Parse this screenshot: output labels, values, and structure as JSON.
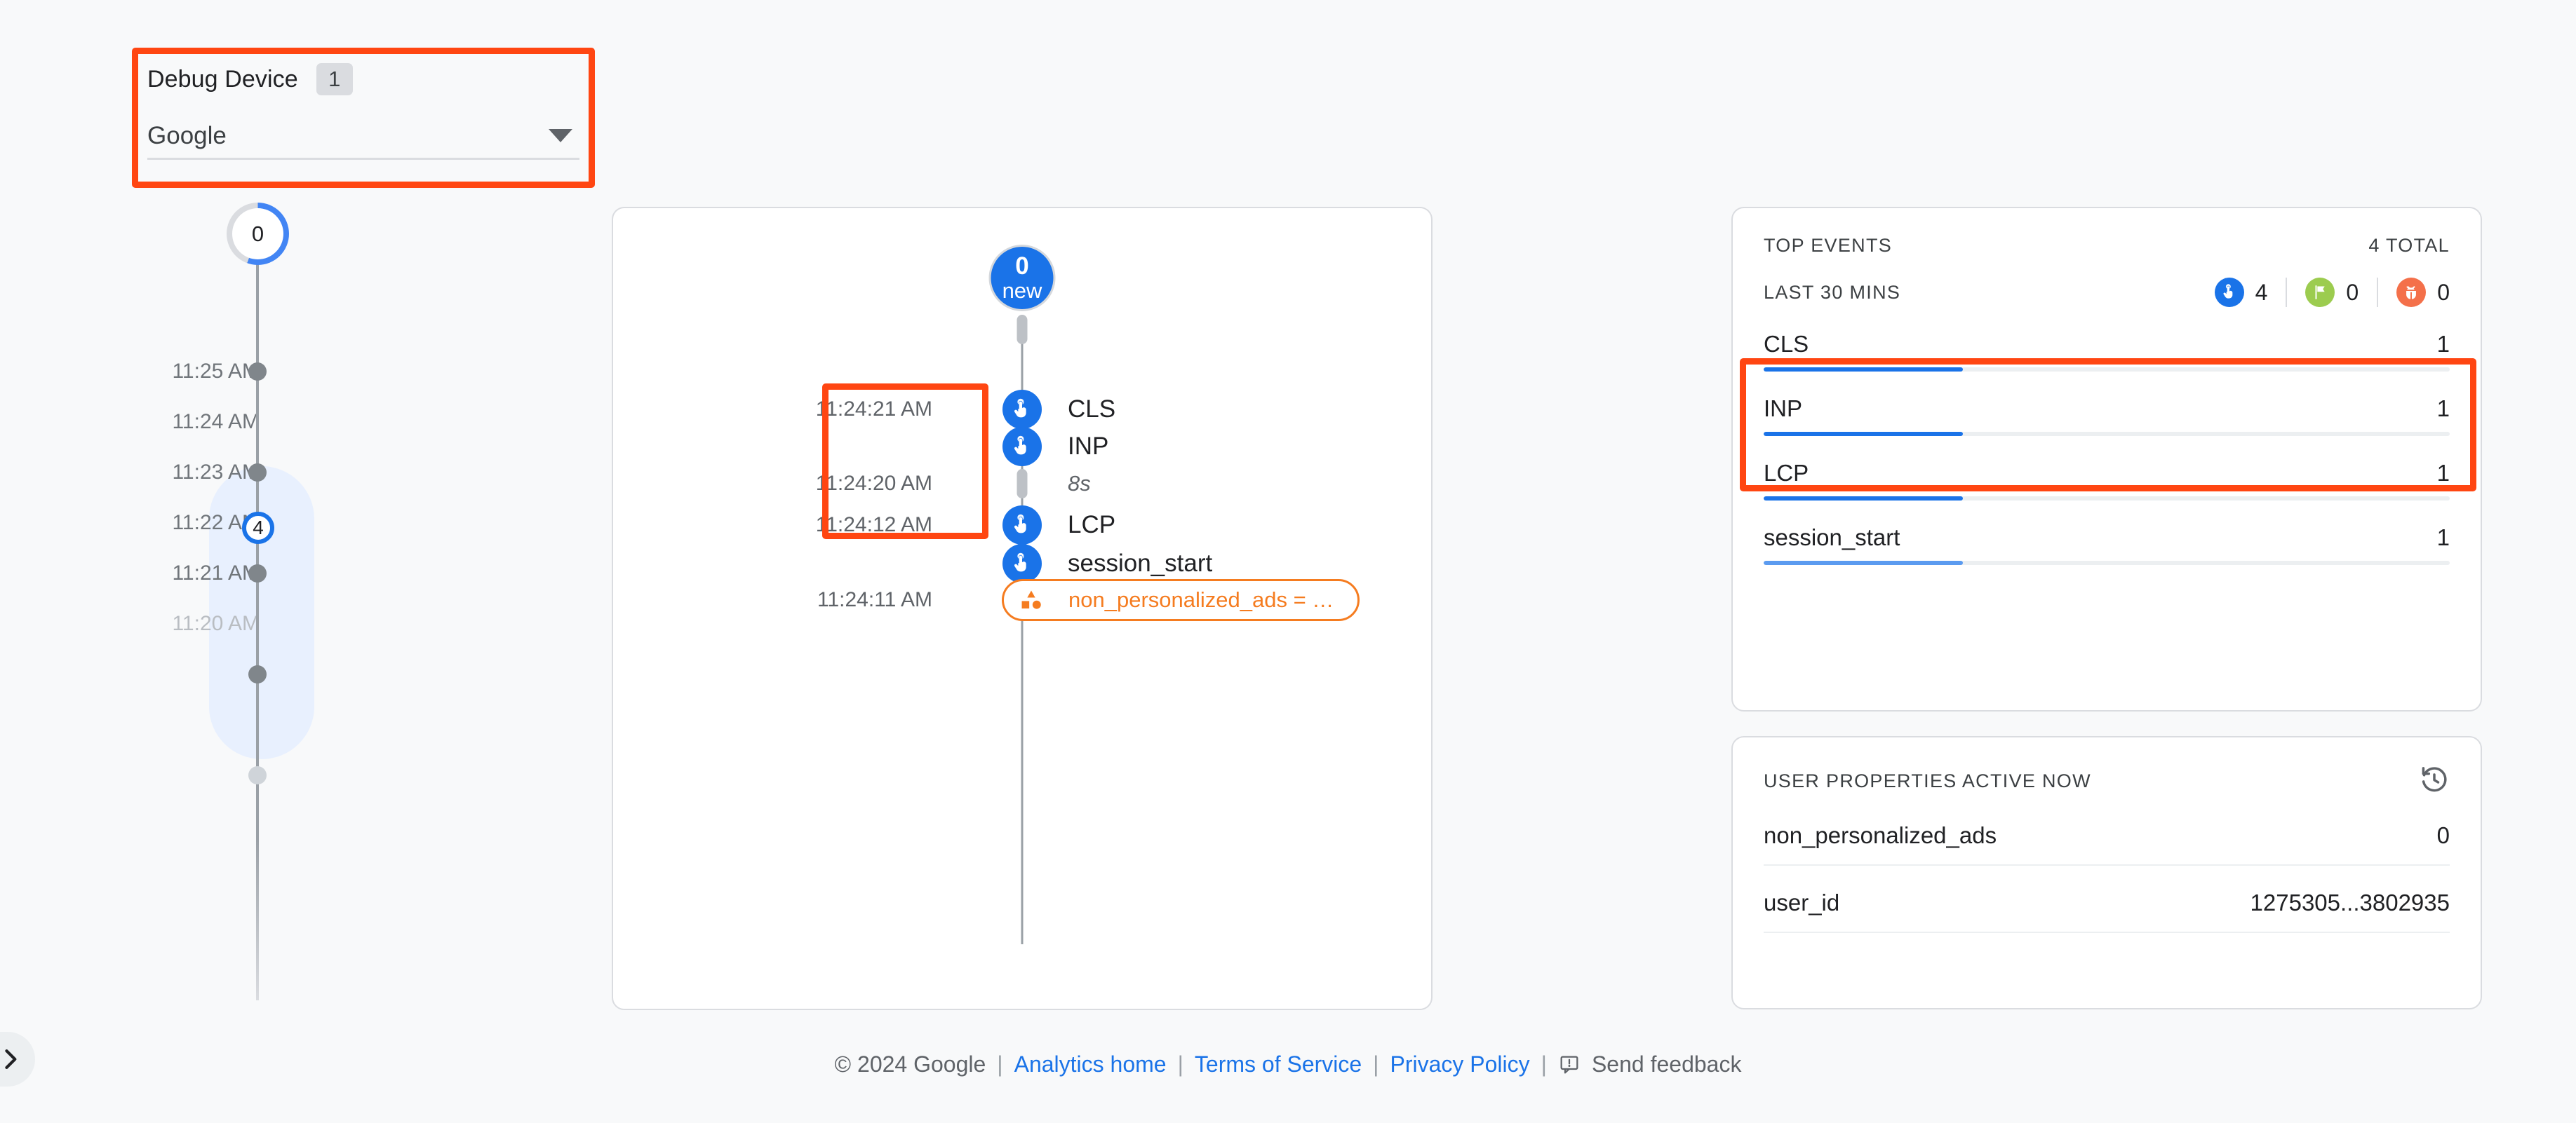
{
  "debug_device": {
    "label": "Debug Device",
    "count": "1",
    "selected": "Google",
    "caret_icon": "chevron-down-icon"
  },
  "timeline_rail": {
    "top_badge_value": "0",
    "top_badge_progress_pct": 55,
    "selected_badge_value": "4",
    "ticks": [
      {
        "time": "11:25 AM",
        "dim": false,
        "has_dot": true
      },
      {
        "time": "11:24 AM",
        "dim": false,
        "has_dot": false
      },
      {
        "time": "11:23 AM",
        "dim": false,
        "has_dot": true
      },
      {
        "time": "11:22 AM",
        "dim": false,
        "has_dot": true
      },
      {
        "time": "11:21 AM",
        "dim": false,
        "has_dot": true
      },
      {
        "time": "11:20 AM",
        "dim": true,
        "has_dot": true
      }
    ]
  },
  "event_stream": {
    "header_badge": {
      "value": "0",
      "caption": "new"
    },
    "items": [
      {
        "kind": "event",
        "time": "11:24:21 AM",
        "label": "CLS",
        "icon": "touch-icon"
      },
      {
        "kind": "event",
        "time": "",
        "label": "INP",
        "icon": "touch-icon"
      },
      {
        "kind": "gap",
        "time": "11:24:20 AM",
        "label": "8s",
        "icon": "gap-pill-icon"
      },
      {
        "kind": "event",
        "time": "11:24:12 AM",
        "label": "LCP",
        "icon": "touch-icon"
      },
      {
        "kind": "event",
        "time": "",
        "label": "session_start",
        "icon": "touch-icon"
      },
      {
        "kind": "chip",
        "time": "11:24:11 AM",
        "label": "non_personalized_ads = …",
        "icon": "shapes-icon"
      }
    ]
  },
  "top_events": {
    "title": "TOP EVENTS",
    "total": "4 TOTAL",
    "range": "LAST 30 MINS",
    "pills": [
      {
        "icon": "touch-icon",
        "count": "4",
        "color": "#1a73e8"
      },
      {
        "icon": "flag-icon",
        "count": "0",
        "color": "#9ccc4f"
      },
      {
        "icon": "bug-icon",
        "count": "0",
        "color": "#f4704a"
      }
    ],
    "rows": [
      {
        "name": "CLS",
        "count": "1",
        "bar_pct": 29,
        "bar_color": "#1a73e8"
      },
      {
        "name": "INP",
        "count": "1",
        "bar_pct": 29,
        "bar_color": "#1a73e8"
      },
      {
        "name": "LCP",
        "count": "1",
        "bar_pct": 29,
        "bar_color": "#1a73e8"
      },
      {
        "name": "session_start",
        "count": "1",
        "bar_pct": 29,
        "bar_color": "#5b9bf0"
      }
    ]
  },
  "user_properties": {
    "title": "USER PROPERTIES ACTIVE NOW",
    "history_icon": "history-icon",
    "rows": [
      {
        "key": "non_personalized_ads",
        "value": "0"
      },
      {
        "key": "user_id",
        "value": "1275305...3802935"
      }
    ]
  },
  "footer": {
    "copyright": "© 2024 Google",
    "links": [
      {
        "label": "Analytics home"
      },
      {
        "label": "Terms of Service"
      },
      {
        "label": "Privacy Policy"
      }
    ],
    "feedback": "Send feedback",
    "feedback_icon": "feedback-icon",
    "separator": "|"
  },
  "expand_handle": {
    "icon": "chevron-right-icon"
  }
}
